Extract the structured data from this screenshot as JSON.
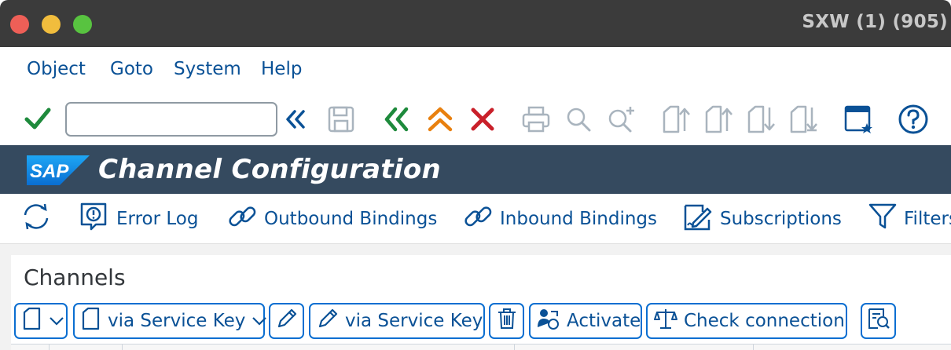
{
  "window": {
    "title": "SXW (1) (905)"
  },
  "menu": {
    "items": [
      "Object",
      "Goto",
      "System",
      "Help"
    ]
  },
  "toolbar": {
    "command_value": ""
  },
  "header": {
    "logo_text": "SAP",
    "title": "Channel Configuration"
  },
  "app_toolbar": {
    "error_log": "Error Log",
    "outbound_bindings": "Outbound Bindings",
    "inbound_bindings": "Inbound Bindings",
    "subscriptions": "Subscriptions",
    "filters": "Filters"
  },
  "channels": {
    "title": "Channels",
    "create_via_service_key": "via Service Key",
    "edit_via_service_key": "via Service Key",
    "activate": "Activate",
    "check_connection": "Check connection"
  },
  "colors": {
    "accent": "#0a5196",
    "header_bg": "#354a5f",
    "titlebar_bg": "#3b3b3b",
    "ok_green": "#1e8a3c",
    "cancel_red": "#c9202a",
    "exit_orange": "#e8800f"
  }
}
